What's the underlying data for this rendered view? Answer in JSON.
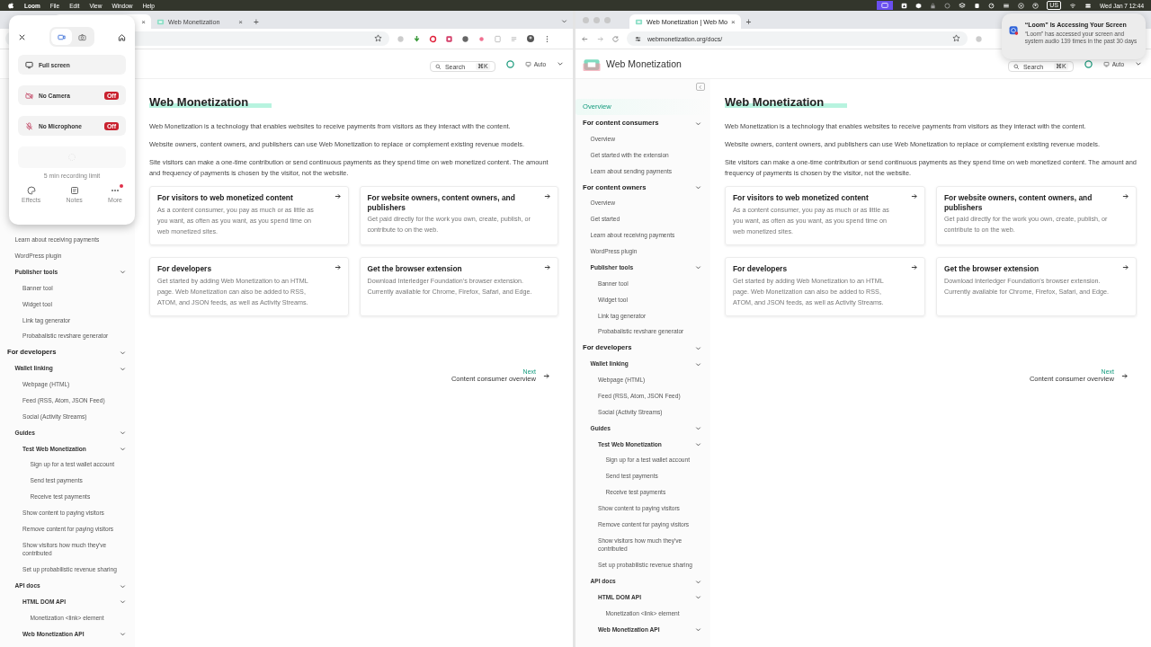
{
  "menubar": {
    "app": "Loom",
    "menus": [
      "File",
      "Edit",
      "View",
      "Window",
      "Help"
    ],
    "input_source": "US",
    "clock": "Wed Jan 7  12:44"
  },
  "loom_panel": {
    "modes": [
      {
        "kind": "video",
        "selected": true
      },
      {
        "kind": "photo",
        "selected": false
      }
    ],
    "options": [
      {
        "kind": "screen",
        "label": "Full screen"
      },
      {
        "kind": "camera",
        "label": "No Camera",
        "badge": "Off",
        "on": false
      },
      {
        "kind": "microphone",
        "label": "No Microphone",
        "badge": "Off",
        "on": false
      }
    ],
    "limit": "5 min recording limit",
    "actions": [
      {
        "kind": "effects",
        "label": "Effects",
        "alert": false
      },
      {
        "kind": "notes",
        "label": "Notes",
        "alert": false
      },
      {
        "kind": "more",
        "label": "More",
        "alert": true
      }
    ]
  },
  "windows": [
    {
      "tab_menu": true,
      "new_tab": "+",
      "tabs": [
        {
          "selected": true,
          "close": "×"
        },
        {
          "title": "Web Monetization",
          "selected": false,
          "close": "×"
        }
      ],
      "search": {
        "label": "Search",
        "shortcut": "⌘K"
      },
      "theme": "Auto",
      "sidebar": [
        {
          "children": [
            {
              "label": "Learn about receiving payments",
              "selected": false
            },
            {
              "label": "WordPress plugin",
              "selected": false
            },
            {
              "label": "Publisher tools",
              "selected": false,
              "expanded": true,
              "children": [
                {
                  "label": "Banner tool",
                  "selected": false
                },
                {
                  "label": "Widget tool",
                  "selected": false
                },
                {
                  "label": "Link tag generator",
                  "selected": false
                },
                {
                  "label": "Probabalistic revshare generator",
                  "selected": false
                }
              ]
            }
          ]
        },
        {
          "label": "For developers",
          "selected": false,
          "expanded": true,
          "children": [
            {
              "label": "Wallet linking",
              "selected": false,
              "expanded": true,
              "children": [
                {
                  "label": "Webpage (HTML)",
                  "selected": false
                },
                {
                  "label": "Feed (RSS, Atom, JSON Feed)",
                  "selected": false
                },
                {
                  "label": "Social (Activity Streams)",
                  "selected": false
                }
              ]
            },
            {
              "label": "Guides",
              "selected": false,
              "expanded": true,
              "children": [
                {
                  "label": "Test Web Monetization",
                  "selected": false,
                  "expanded": true,
                  "children": [
                    {
                      "label": "Sign up for a test wallet account",
                      "selected": false
                    },
                    {
                      "label": "Send test payments",
                      "selected": false
                    },
                    {
                      "label": "Receive test payments",
                      "selected": false
                    }
                  ]
                },
                {
                  "label": "Show content to paying visitors",
                  "selected": false
                },
                {
                  "label": "Remove content for paying visitors",
                  "selected": false
                },
                {
                  "label": "Show visitors how much they've contributed",
                  "selected": false
                },
                {
                  "label": "Set up probabilistic revenue sharing",
                  "selected": false
                }
              ]
            },
            {
              "label": "API docs",
              "selected": false,
              "expanded": true,
              "children": [
                {
                  "label": "HTML DOM API",
                  "selected": false,
                  "expanded": true,
                  "children": [
                    {
                      "label": "Monetization <link> element",
                      "selected": false
                    }
                  ]
                },
                {
                  "label": "Web Monetization API",
                  "selected": false,
                  "expanded": true
                }
              ]
            }
          ]
        }
      ],
      "content": {
        "title": "Web Monetization",
        "paragraphs": [
          "Web Monetization is a technology that enables websites to receive payments from visitors as they interact with the content.",
          "Website owners, content owners, and publishers can use Web Monetization to replace or complement existing revenue models.",
          "Site visitors can make a one-time contribution or send continuous payments as they spend time on web monetized content. The amount and frequency of payments is chosen by the visitor, not the website."
        ],
        "cards": [
          {
            "title": "For visitors to web monetized content",
            "text": "As a content consumer, you pay as much or as little as you want, as often as you want, as you spend time on web monetized sites."
          },
          {
            "title": "For website owners, content owners, and publishers",
            "text": "Get paid directly for the work you own, create, publish, or contribute to on the web."
          },
          {
            "title": "For developers",
            "text": "Get started by adding Web Monetization to an HTML page. Web Monetization can also be added to RSS, ATOM, and JSON feeds, as well as Activity Streams."
          },
          {
            "title": "Get the browser extension",
            "text": "Download Interledger Foundation's browser extension. Currently available for Chrome, Firefox, Safari, and Edge."
          }
        ],
        "next": {
          "label": "Next",
          "title": "Content consumer overview"
        }
      }
    },
    {
      "new_tab": "+",
      "tabs": [
        {
          "title": "Web Monetization | Web Mo",
          "selected": true,
          "close": "×"
        }
      ],
      "address": "webmonetization.org/docs/",
      "site_title": "Web Monetization",
      "search": {
        "label": "Search",
        "shortcut": "⌘K"
      },
      "theme": "Auto",
      "sidebar": [
        {
          "label": "Overview",
          "selected": true
        },
        {
          "label": "For content consumers",
          "selected": false,
          "expanded": true,
          "children": [
            {
              "label": "Overview",
              "selected": false
            },
            {
              "label": "Get started with the extension",
              "selected": false
            },
            {
              "label": "Learn about sending payments",
              "selected": false
            }
          ]
        },
        {
          "label": "For content owners",
          "selected": false,
          "expanded": true,
          "children": [
            {
              "label": "Overview",
              "selected": false
            },
            {
              "label": "Get started",
              "selected": false
            },
            {
              "label": "Learn about receiving payments",
              "selected": false
            },
            {
              "label": "WordPress plugin",
              "selected": false
            },
            {
              "label": "Publisher tools",
              "selected": false,
              "expanded": true,
              "children": [
                {
                  "label": "Banner tool",
                  "selected": false
                },
                {
                  "label": "Widget tool",
                  "selected": false
                },
                {
                  "label": "Link tag generator",
                  "selected": false
                },
                {
                  "label": "Probabalistic revshare generator",
                  "selected": false
                }
              ]
            }
          ]
        },
        {
          "label": "For developers",
          "selected": false,
          "expanded": true,
          "children": [
            {
              "label": "Wallet linking",
              "selected": false,
              "expanded": true,
              "children": [
                {
                  "label": "Webpage (HTML)",
                  "selected": false
                },
                {
                  "label": "Feed (RSS, Atom, JSON Feed)",
                  "selected": false
                },
                {
                  "label": "Social (Activity Streams)",
                  "selected": false
                }
              ]
            },
            {
              "label": "Guides",
              "selected": false,
              "expanded": true,
              "children": [
                {
                  "label": "Test Web Monetization",
                  "selected": false,
                  "expanded": true,
                  "children": [
                    {
                      "label": "Sign up for a test wallet account",
                      "selected": false
                    },
                    {
                      "label": "Send test payments",
                      "selected": false
                    },
                    {
                      "label": "Receive test payments",
                      "selected": false
                    }
                  ]
                },
                {
                  "label": "Show content to paying visitors",
                  "selected": false
                },
                {
                  "label": "Remove content for paying visitors",
                  "selected": false
                },
                {
                  "label": "Show visitors how much they've contributed",
                  "selected": false
                },
                {
                  "label": "Set up probabilistic revenue sharing",
                  "selected": false
                }
              ]
            },
            {
              "label": "API docs",
              "selected": false,
              "expanded": true,
              "children": [
                {
                  "label": "HTML DOM API",
                  "selected": false,
                  "expanded": true,
                  "children": [
                    {
                      "label": "Monetization <link> element",
                      "selected": false
                    }
                  ]
                },
                {
                  "label": "Web Monetization API",
                  "selected": false,
                  "expanded": true
                }
              ]
            }
          ]
        }
      ],
      "content": {
        "title": "Web Monetization",
        "paragraphs": [
          "Web Monetization is a technology that enables websites to receive payments from visitors as they interact with the content.",
          "Website owners, content owners, and publishers can use Web Monetization to replace or complement existing revenue models.",
          "Site visitors can make a one-time contribution or send continuous payments as they spend time on web monetized content. The amount and frequency of payments is chosen by the visitor, not the website."
        ],
        "cards": [
          {
            "title": "For visitors to web monetized content",
            "text": "As a content consumer, you pay as much or as little as you want, as often as you want, as you spend time on web monetized sites."
          },
          {
            "title": "For website owners, content owners, and publishers",
            "text": "Get paid directly for the work you own, create, publish, or contribute to on the web."
          },
          {
            "title": "For developers",
            "text": "Get started by adding Web Monetization to an HTML page. Web Monetization can also be added to RSS, ATOM, and JSON feeds, as well as Activity Streams."
          },
          {
            "title": "Get the browser extension",
            "text": "Download Interledger Foundation's browser extension. Currently available for Chrome, Firefox, Safari, and Edge."
          }
        ],
        "next": {
          "label": "Next",
          "title": "Content consumer overview"
        }
      }
    }
  ],
  "notification": {
    "title": "“Loom” Is Accessing Your Screen",
    "body": "“Loom” has accessed your screen and system audio 139 times in the past 30 days"
  }
}
